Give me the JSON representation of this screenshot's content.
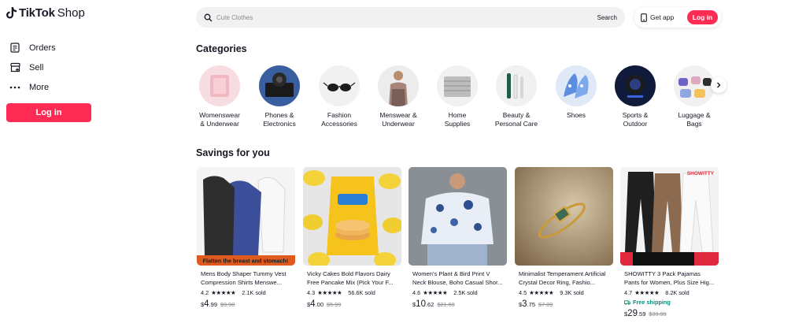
{
  "brand": {
    "logo_word": "TikTok",
    "logo_shop": "Shop"
  },
  "sidebar": {
    "items": [
      {
        "label": "Orders",
        "icon": "orders-icon"
      },
      {
        "label": "Sell",
        "icon": "sell-icon"
      },
      {
        "label": "More",
        "icon": "more-icon"
      }
    ],
    "login_label": "Log in"
  },
  "search": {
    "placeholder": "Cute Clothes",
    "button_label": "Search"
  },
  "topbar": {
    "get_app_label": "Get app",
    "login_label": "Log in"
  },
  "categories": {
    "title": "Categories",
    "items": [
      {
        "line1": "Womenswear",
        "line2": "& Underwear"
      },
      {
        "line1": "Phones &",
        "line2": "Electronics"
      },
      {
        "line1": "Fashion",
        "line2": "Accessories"
      },
      {
        "line1": "Menswear &",
        "line2": "Underwear"
      },
      {
        "line1": "Home",
        "line2": "Supplies"
      },
      {
        "line1": "Beauty &",
        "line2": "Personal Care"
      },
      {
        "line1": "Shoes",
        "line2": ""
      },
      {
        "line1": "Sports &",
        "line2": "Outdoor"
      },
      {
        "line1": "Luggage &",
        "line2": "Bags"
      }
    ]
  },
  "savings": {
    "title": "Savings for you",
    "products": [
      {
        "title": "Mens Body Shaper Tummy Vest Compression Shirts Menswe...",
        "rating": "4.2",
        "sold": "2.1K sold",
        "free_shipping": "",
        "price_cur": "$",
        "price_int": "4",
        "price_dec": ".99",
        "price_orig": "$9.98",
        "image_banner": "Flatten the breast and stomach!"
      },
      {
        "title": "Vicky Cakes Bold Flavors Dairy Free Pancake Mix (Pick Your F...",
        "rating": "4.3",
        "sold": "56.6K sold",
        "free_shipping": "",
        "price_cur": "$",
        "price_int": "4",
        "price_dec": ".00",
        "price_orig": "$5.99",
        "image_banner": ""
      },
      {
        "title": "Women's Plant & Bird Print V Neck Blouse, Boho Casual Shor...",
        "rating": "4.6",
        "sold": "2.5K sold",
        "free_shipping": "",
        "price_cur": "$",
        "price_int": "10",
        "price_dec": ".62",
        "price_orig": "$21.69",
        "image_banner": ""
      },
      {
        "title": "Minimalist Temperament Artificial Crystal Decor Ring, Fashio...",
        "rating": "4.5",
        "sold": "9.3K sold",
        "free_shipping": "",
        "price_cur": "$",
        "price_int": "3",
        "price_dec": ".75",
        "price_orig": "$7.09",
        "image_banner": ""
      },
      {
        "title": "SHOWITTY 3 Pack Pajamas Pants for Women, Plus Size Hig...",
        "rating": "4.7",
        "sold": "8.2K sold",
        "free_shipping": "Free shipping",
        "price_cur": "$",
        "price_int": "29",
        "price_dec": ".59",
        "price_orig": "$39.99",
        "image_banner": "SHOWITTY"
      }
    ]
  },
  "colors": {
    "accent": "#fe2c55",
    "text": "#161823",
    "muted": "#8a8b91",
    "free_shipping": "#0a8a79",
    "search_bg": "#f1f1f2"
  }
}
